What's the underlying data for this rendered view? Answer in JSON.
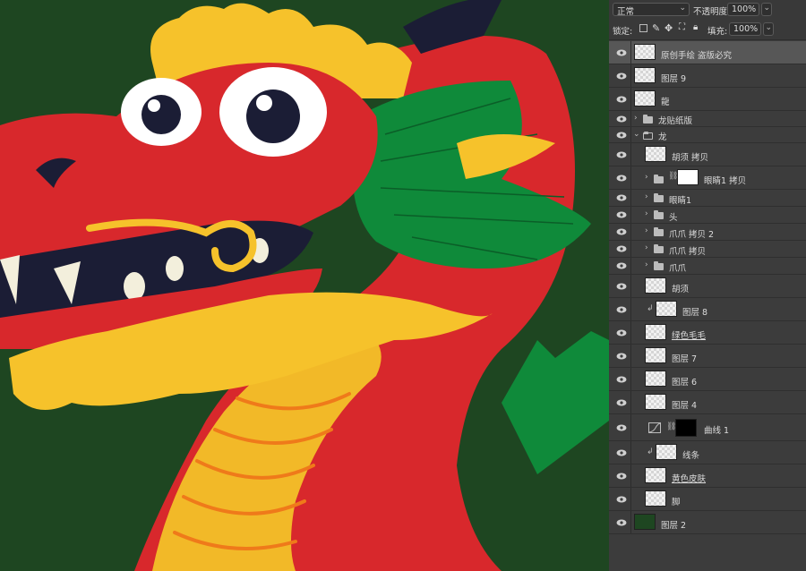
{
  "panel": {
    "blend_mode": "正常",
    "opacity_label": "不透明度:",
    "opacity_value": "100%",
    "lock_label": "锁定:",
    "fill_label": "填充:",
    "fill_value": "100%"
  },
  "layers": [
    {
      "name": "原创手绘 盗版必究",
      "kind": "layer",
      "selected": true
    },
    {
      "name": "图层 9",
      "kind": "layer"
    },
    {
      "name": "龍",
      "kind": "layer"
    },
    {
      "name": "龙贴纸版",
      "kind": "group"
    },
    {
      "name": "龙",
      "kind": "group-open"
    },
    {
      "name": "胡须 拷贝",
      "kind": "layer",
      "indent": 1
    },
    {
      "name": "眼睛1 拷贝",
      "kind": "group-mask",
      "indent": 1
    },
    {
      "name": "眼睛1",
      "kind": "group",
      "indent": 1
    },
    {
      "name": "头",
      "kind": "group",
      "indent": 1
    },
    {
      "name": "爪爪 拷贝 2",
      "kind": "group",
      "indent": 1
    },
    {
      "name": "爪爪 拷贝",
      "kind": "group",
      "indent": 1
    },
    {
      "name": "爪爪",
      "kind": "group",
      "indent": 1
    },
    {
      "name": "胡须",
      "kind": "layer",
      "indent": 1
    },
    {
      "name": "图层 8",
      "kind": "layer",
      "indent": 1,
      "clipped": true
    },
    {
      "name": "绿色毛毛",
      "kind": "layer",
      "indent": 1,
      "underline": true
    },
    {
      "name": "图层 7",
      "kind": "layer",
      "indent": 1
    },
    {
      "name": "图层 6",
      "kind": "layer",
      "indent": 1
    },
    {
      "name": "图层 4",
      "kind": "layer",
      "indent": 1
    },
    {
      "name": "曲线 1",
      "kind": "adjustment",
      "indent": 1
    },
    {
      "name": "线条",
      "kind": "layer",
      "indent": 1,
      "clipped": true
    },
    {
      "name": "黄色皮肤",
      "kind": "layer",
      "indent": 1,
      "underline": true
    },
    {
      "name": "脚",
      "kind": "layer",
      "indent": 1
    },
    {
      "name": "图层 2",
      "kind": "layer",
      "solid": true
    }
  ],
  "colors": {
    "canvas_bg": "#1e4621",
    "dragon_red": "#d8282c",
    "dragon_yellow": "#f6c22b",
    "dragon_green": "#0f8a3a",
    "panel_bg": "#3c3c3c"
  }
}
